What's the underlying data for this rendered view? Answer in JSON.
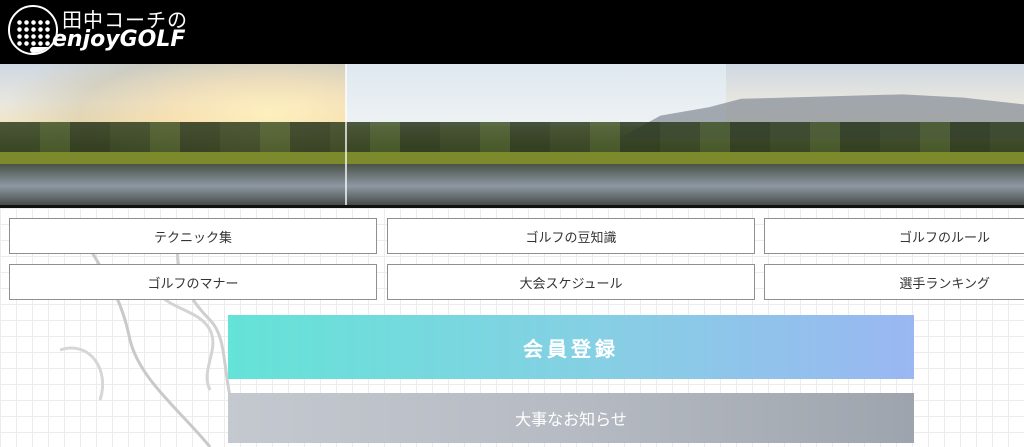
{
  "header": {
    "logo_title": "田中コーチの",
    "logo_subtitle": "enjoyGOLF"
  },
  "hero": {
    "image_description_icon": "golf-course-landscape-icon"
  },
  "nav": {
    "items": [
      {
        "label": "テクニック集"
      },
      {
        "label": "ゴルフの豆知識"
      },
      {
        "label": "ゴルフのルール"
      },
      {
        "label": "ゴルフのマナー"
      },
      {
        "label": "大会スケジュール"
      },
      {
        "label": "選手ランキング"
      }
    ]
  },
  "actions": {
    "member_label": "会員登録",
    "notice_label": "大事なお知らせ"
  },
  "colors": {
    "header_bg": "#000000",
    "member_gradient_start": "#64e3d7",
    "member_gradient_end": "#9ab7f2",
    "notice_gradient_start": "#c4c8cf",
    "notice_gradient_end": "#9ea4ad"
  }
}
